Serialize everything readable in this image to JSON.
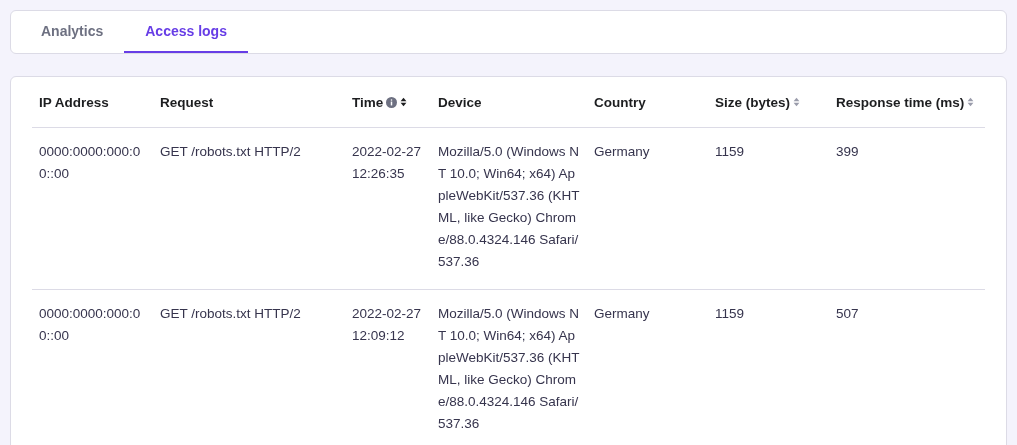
{
  "tabs": [
    {
      "label": "Analytics",
      "selected": false
    },
    {
      "label": "Access logs",
      "selected": true
    }
  ],
  "table": {
    "columns": [
      {
        "label": "IP Address",
        "info": false,
        "sortable": false,
        "sorted_desc": false
      },
      {
        "label": "Request",
        "info": false,
        "sortable": false,
        "sorted_desc": false
      },
      {
        "label": "Time",
        "info": true,
        "sortable": true,
        "sorted_desc": true
      },
      {
        "label": "Device",
        "info": false,
        "sortable": false,
        "sorted_desc": false
      },
      {
        "label": "Country",
        "info": false,
        "sortable": false,
        "sorted_desc": false
      },
      {
        "label": "Size (bytes)",
        "info": false,
        "sortable": true,
        "sorted_desc": false
      },
      {
        "label": "Response time (ms)",
        "info": false,
        "sortable": true,
        "sorted_desc": false
      }
    ],
    "rows": [
      [
        "0000:0000:000:00::00",
        "GET /robots.txt HTTP/2",
        "2022-02-27 12:26:35",
        "Mozilla/5.0 (Windows NT 10.0; Win64; x64) AppleWebKit/537.36 (KHTML, like Gecko) Chrome/88.0.4324.146 Safari/537.36",
        "Germany",
        "1159",
        "399"
      ],
      [
        "0000:0000:000:00::00",
        "GET /robots.txt HTTP/2",
        "2022-02-27 12:09:12",
        "Mozilla/5.0 (Windows NT 10.0; Win64; x64) AppleWebKit/537.36 (KHTML, like Gecko) Chrome/88.0.4324.146 Safari/537.36",
        "Germany",
        "1159",
        "507"
      ]
    ]
  }
}
